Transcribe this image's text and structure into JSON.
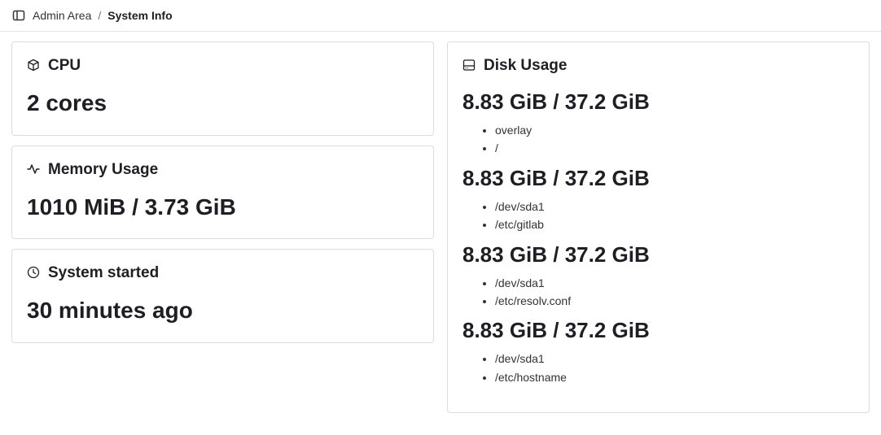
{
  "breadcrumb": {
    "parent": "Admin Area",
    "separator": "/",
    "current": "System Info"
  },
  "cpu": {
    "title": "CPU",
    "value": "2 cores"
  },
  "memory": {
    "title": "Memory Usage",
    "value": "1010 MiB / 3.73 GiB"
  },
  "uptime": {
    "title": "System started",
    "value": "30 minutes ago"
  },
  "disk": {
    "title": "Disk Usage",
    "entries": [
      {
        "usage": "8.83 GiB / 37.2 GiB",
        "mounts": [
          "overlay",
          "/"
        ]
      },
      {
        "usage": "8.83 GiB / 37.2 GiB",
        "mounts": [
          "/dev/sda1",
          "/etc/gitlab"
        ]
      },
      {
        "usage": "8.83 GiB / 37.2 GiB",
        "mounts": [
          "/dev/sda1",
          "/etc/resolv.conf"
        ]
      },
      {
        "usage": "8.83 GiB / 37.2 GiB",
        "mounts": [
          "/dev/sda1",
          "/etc/hostname"
        ]
      }
    ]
  }
}
